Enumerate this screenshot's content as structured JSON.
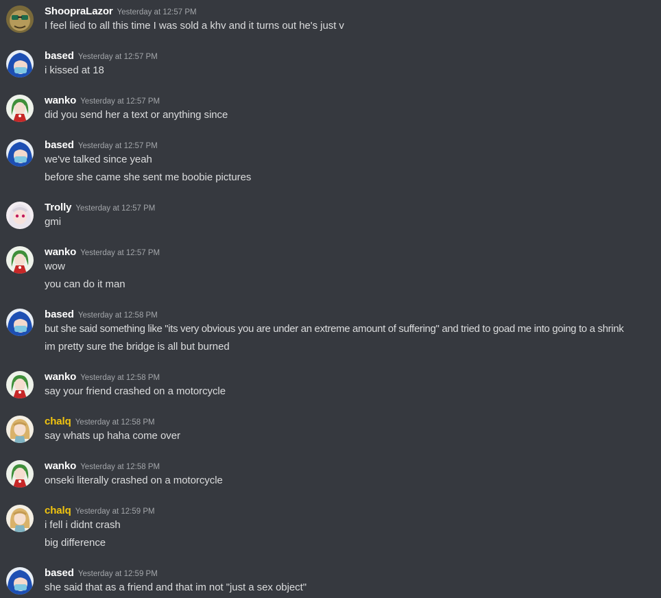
{
  "colors": {
    "background": "#36393f",
    "username_default": "#ffffff",
    "username_gold": "#f1c40f",
    "timestamp": "#a3a6aa",
    "message_text": "#dcddde"
  },
  "messages": [
    {
      "author": "ShoopraLazor",
      "avatar": "sunglasses-avatar-icon",
      "timestamp": "Yesterday at 12:57 PM",
      "lines": [
        "I feel lied to all this time I was sold a khv and it turns out he's just v"
      ]
    },
    {
      "author": "based",
      "avatar": "blue-hair-avatar-icon",
      "timestamp": "Yesterday at 12:57 PM",
      "lines": [
        "i kissed at 18"
      ]
    },
    {
      "author": "wanko",
      "avatar": "green-hair-avatar-icon",
      "timestamp": "Yesterday at 12:57 PM",
      "lines": [
        "did you send her a text or anything since"
      ]
    },
    {
      "author": "based",
      "avatar": "blue-hair-avatar-icon",
      "timestamp": "Yesterday at 12:57 PM",
      "lines": [
        "we've talked since yeah",
        "before she came she sent me boobie pictures"
      ]
    },
    {
      "author": "Trolly",
      "avatar": "white-hair-avatar-icon",
      "timestamp": "Yesterday at 12:57 PM",
      "lines": [
        "gmi"
      ]
    },
    {
      "author": "wanko",
      "avatar": "green-hair-avatar-icon",
      "timestamp": "Yesterday at 12:57 PM",
      "lines": [
        "wow",
        "you can do it man"
      ]
    },
    {
      "author": "based",
      "avatar": "blue-hair-avatar-icon",
      "timestamp": "Yesterday at 12:58 PM",
      "lines": [
        "but she said something like \"its very obvious you are under an extreme amount of suffering\" and tried to goad me into going to a shrink",
        "im pretty sure the bridge is all but burned"
      ]
    },
    {
      "author": "wanko",
      "avatar": "green-hair-avatar-icon",
      "timestamp": "Yesterday at 12:58 PM",
      "lines": [
        "say your friend crashed on a motorcycle"
      ]
    },
    {
      "author": "chalq",
      "avatar": "blonde-avatar-icon",
      "timestamp": "Yesterday at 12:58 PM",
      "lines": [
        "say whats up haha come over"
      ]
    },
    {
      "author": "wanko",
      "avatar": "green-hair-avatar-icon",
      "timestamp": "Yesterday at 12:58 PM",
      "lines": [
        "onseki literally crashed on a motorcycle"
      ]
    },
    {
      "author": "chalq",
      "avatar": "blonde-avatar-icon",
      "timestamp": "Yesterday at 12:59 PM",
      "lines": [
        "i fell i didnt crash",
        "big difference"
      ]
    },
    {
      "author": "based",
      "avatar": "blue-hair-avatar-icon",
      "timestamp": "Yesterday at 12:59 PM",
      "lines": [
        "she said that as a friend and that im not \"just a sex object\""
      ]
    }
  ]
}
